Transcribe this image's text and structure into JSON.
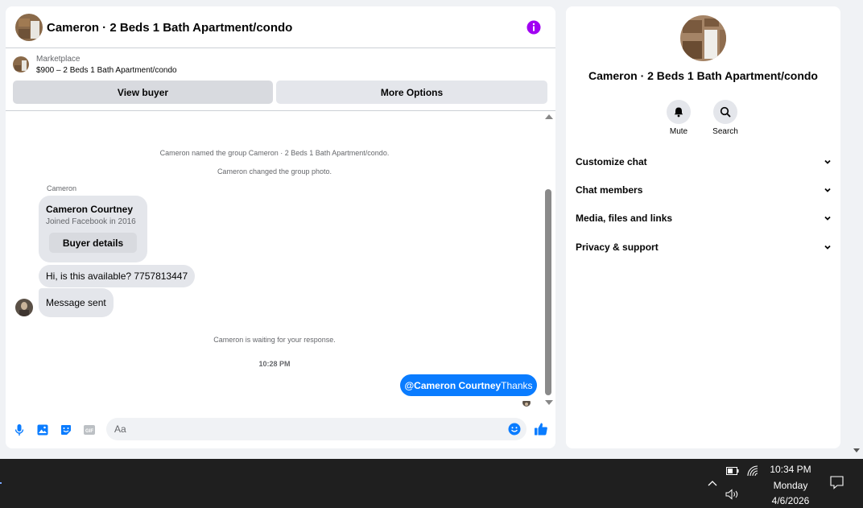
{
  "chat": {
    "title": "Cameron · 2 Beds 1 Bath Apartment/condo",
    "listing": {
      "kind": "Marketplace",
      "price_title": "$900 – 2 Beds 1 Bath Apartment/condo"
    },
    "buttons": {
      "view_buyer": "View buyer",
      "more_options": "More Options"
    },
    "messages": {
      "system_rename": "Cameron named the group Cameron · 2 Beds 1 Bath Apartment/condo.",
      "system_photo": "Cameron changed the group photo.",
      "sender": "Cameron",
      "buyer_card": {
        "name": "Cameron Courtney",
        "joined": "Joined Facebook in 2016",
        "button": "Buyer details"
      },
      "incoming_1": "Hi, is this available? 7757813447",
      "incoming_2": "Message sent",
      "system_waiting": "Cameron is waiting for your response.",
      "timestamp": "10:28 PM",
      "outgoing": {
        "mention": "@Cameron Courtney",
        "text": "Thanks"
      }
    },
    "composer": {
      "placeholder": "Aa",
      "icons": [
        "microphone-icon",
        "image-icon",
        "sticker-icon",
        "gif-icon",
        "emoji-icon",
        "like-icon"
      ]
    }
  },
  "info_panel": {
    "title": "Cameron · 2 Beds 1 Bath Apartment/condo",
    "actions": [
      {
        "label": "Mute",
        "icon": "bell-icon"
      },
      {
        "label": "Search",
        "icon": "search-icon"
      }
    ],
    "sections": [
      {
        "label": "Customize chat"
      },
      {
        "label": "Chat members"
      },
      {
        "label": "Media, files and links"
      },
      {
        "label": "Privacy & support"
      }
    ]
  },
  "taskbar": {
    "time": "10:34 PM",
    "day": "Monday",
    "date": "4/6/2026"
  },
  "colors": {
    "accent": "#0a7cff",
    "info_icon": "#a100f2",
    "taskbar": "#1f1f1f"
  }
}
